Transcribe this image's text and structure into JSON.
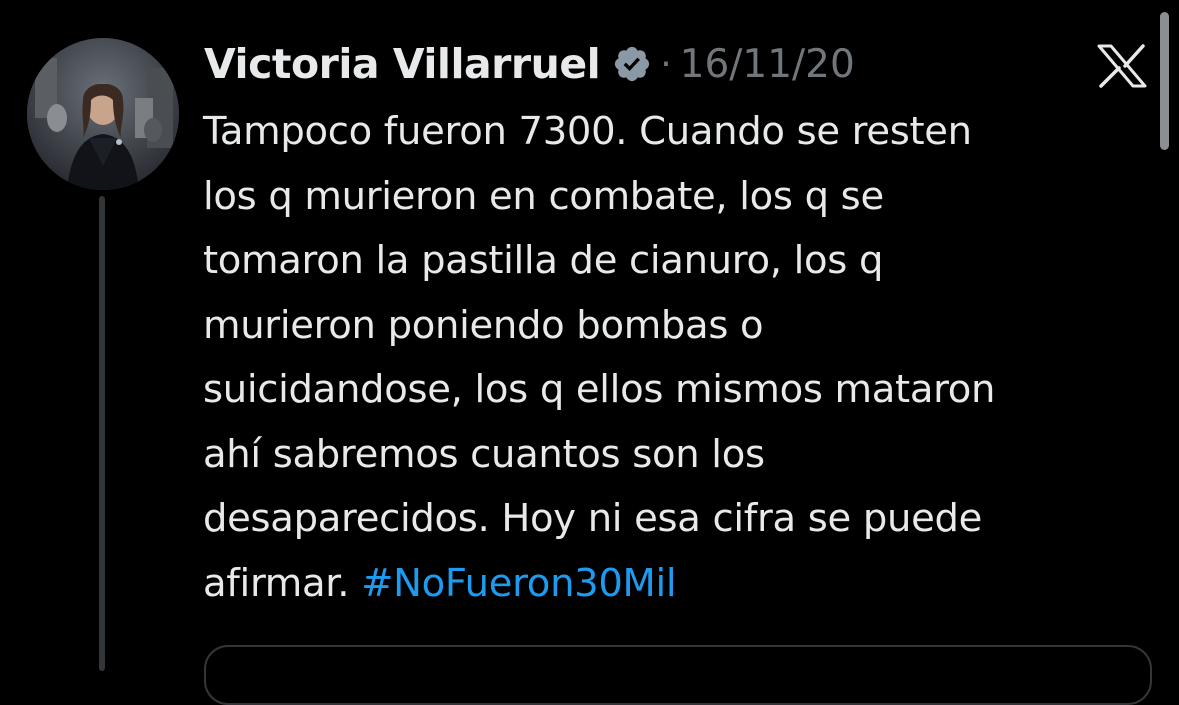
{
  "tweet": {
    "author": {
      "name": "Victoria Villarruel",
      "verified": true,
      "avatar_icon": "profile-photo"
    },
    "separator": "·",
    "date": "16/11/20",
    "body_lines": [
      "Tampoco fueron 7300. Cuando se resten",
      "los q murieron en combate, los q se",
      "tomaron la pastilla de cianuro, los q",
      "murieron poniendo bombas o",
      "suicidandose, los q ellos mismos mataron",
      "ahí sabremos cuantos son los",
      "desaparecidos. Hoy ni esa cifra se puede"
    ],
    "last_line_text": "afirmar.",
    "hashtag": "#NoFueron30Mil"
  },
  "icons": {
    "verified": "verified-badge-icon",
    "platform_logo": "x-logo-icon"
  },
  "colors": {
    "background": "#000000",
    "text": "#e7e9ea",
    "secondary_text": "#71767b",
    "hashtag": "#1d9bf0",
    "thread_line": "#333639"
  }
}
